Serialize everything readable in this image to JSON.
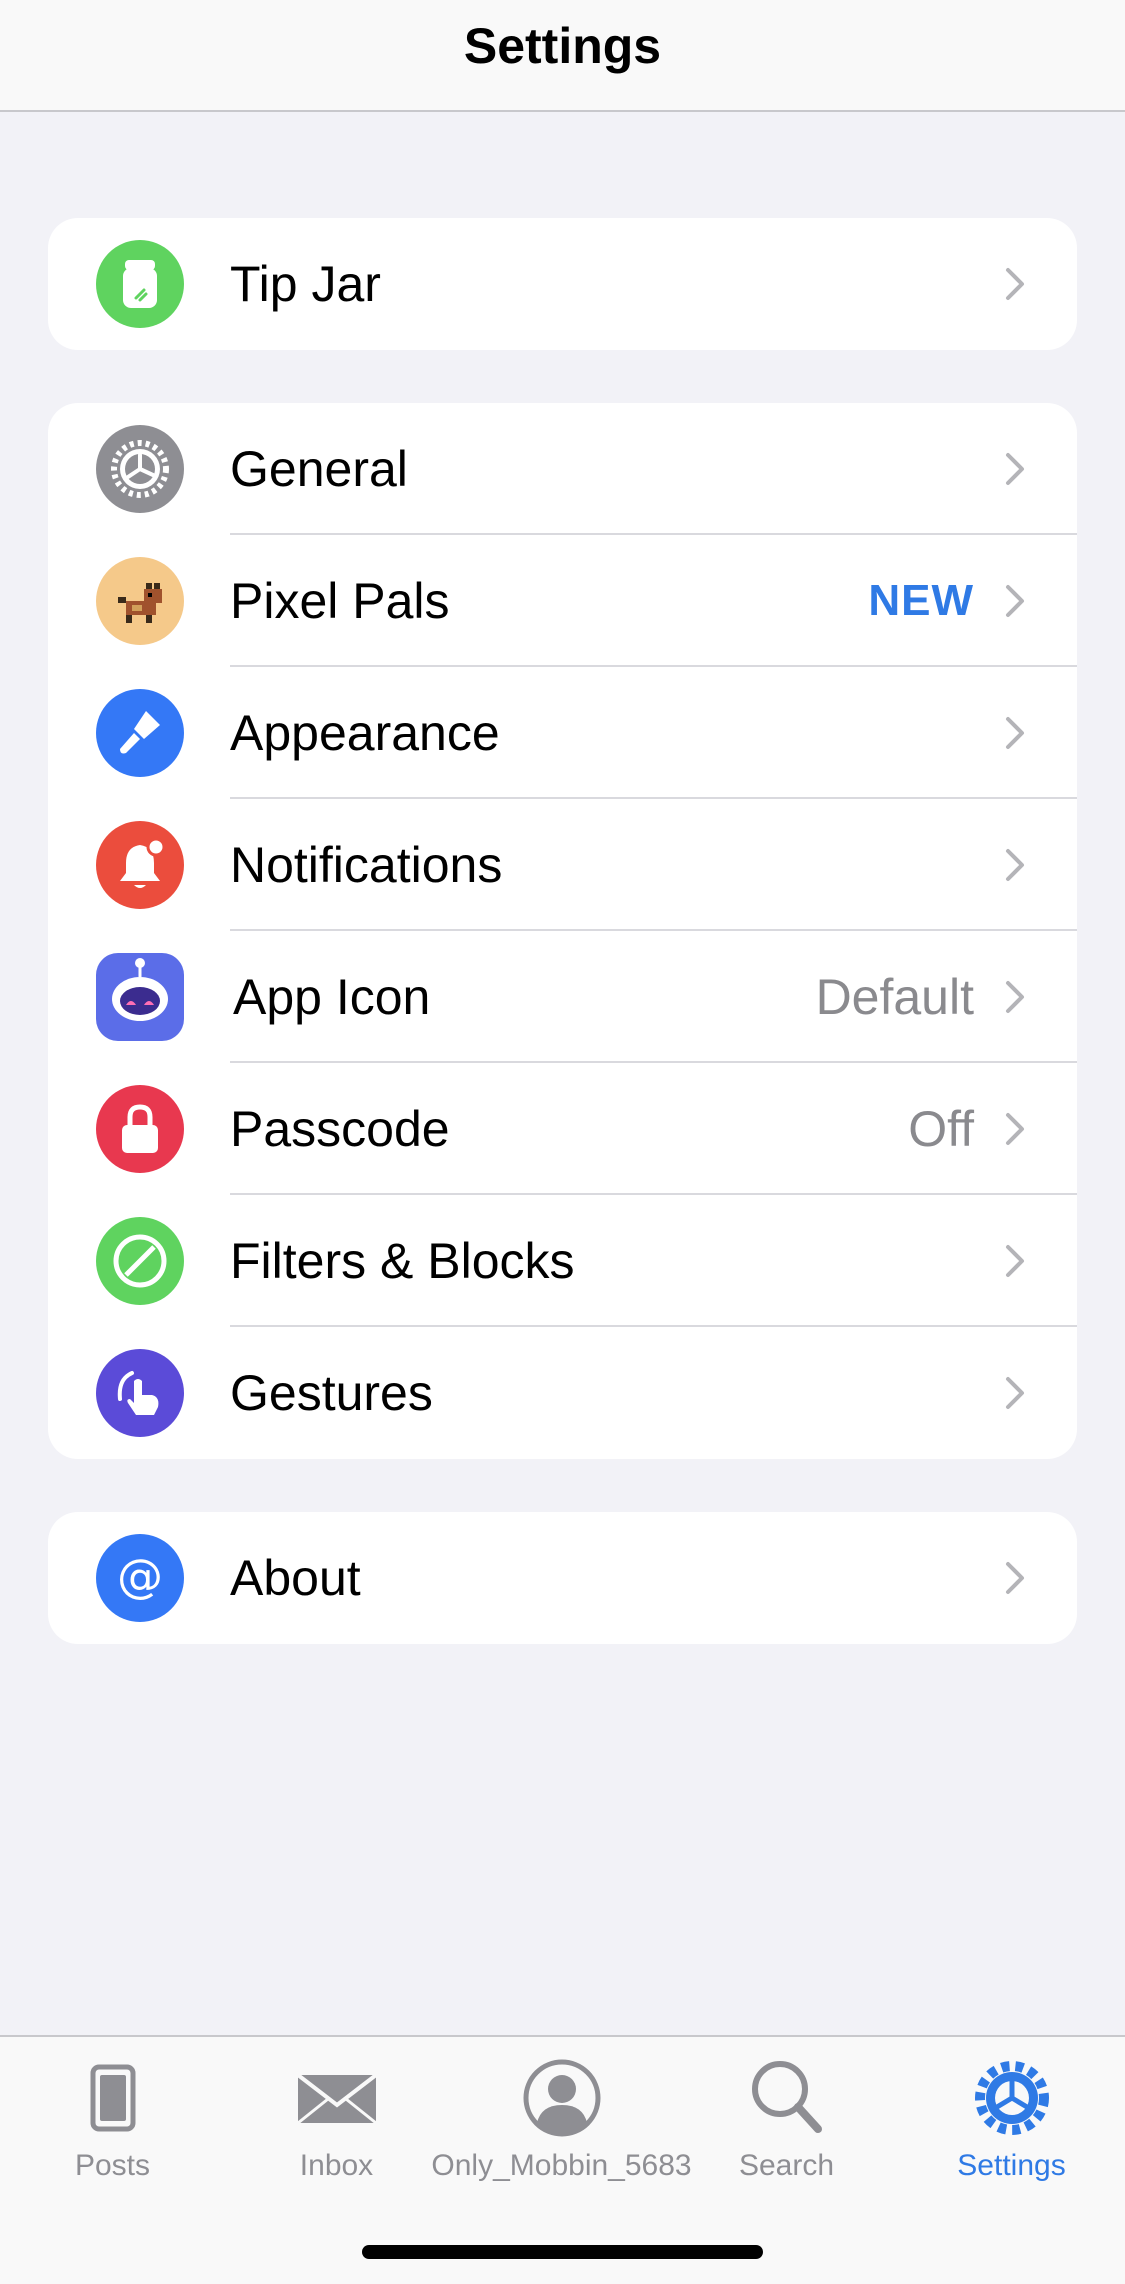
{
  "header": {
    "title": "Settings"
  },
  "groups": {
    "tipjar": {
      "label": "Tip Jar"
    },
    "main": {
      "general": {
        "label": "General"
      },
      "pixelpals": {
        "label": "Pixel Pals",
        "value": "NEW"
      },
      "appearance": {
        "label": "Appearance"
      },
      "notifications": {
        "label": "Notifications"
      },
      "appicon": {
        "label": "App Icon",
        "value": "Default"
      },
      "passcode": {
        "label": "Passcode",
        "value": "Off"
      },
      "filters": {
        "label": "Filters & Blocks"
      },
      "gestures": {
        "label": "Gestures"
      }
    },
    "about": {
      "label": "About"
    }
  },
  "tabs": {
    "posts": {
      "label": "Posts",
      "icon": "posts-icon"
    },
    "inbox": {
      "label": "Inbox",
      "icon": "inbox-icon"
    },
    "profile": {
      "label": "Only_Mobbin_5683",
      "icon": "profile-icon"
    },
    "search": {
      "label": "Search",
      "icon": "search-icon"
    },
    "settings": {
      "label": "Settings",
      "icon": "gear-icon",
      "active": true
    }
  },
  "colors": {
    "accent": "#2f7ae5",
    "tipjar": "#5fd35f",
    "general": "#8e8e93",
    "pixelpals": "#f5c98a",
    "appearance": "#3478f6",
    "notifications": "#eb4d3d",
    "appicon": "#5b6de8",
    "passcode": "#e8384f",
    "filters": "#5fd35f",
    "gestures": "#5b4bd8",
    "about": "#3478f6"
  }
}
